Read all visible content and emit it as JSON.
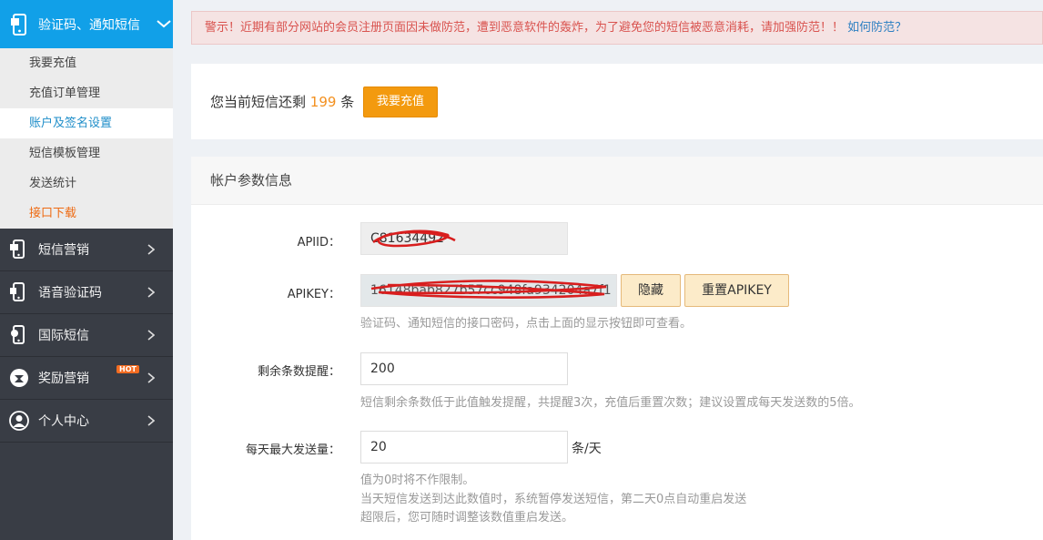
{
  "sidebar": {
    "active_menu": {
      "label": "验证码、通知短信",
      "icon": "phone-icon"
    },
    "submenu": [
      {
        "label": "我要充值",
        "state": "normal"
      },
      {
        "label": "充值订单管理",
        "state": "normal"
      },
      {
        "label": "账户及签名设置",
        "state": "selected"
      },
      {
        "label": "短信模板管理",
        "state": "normal"
      },
      {
        "label": "发送统计",
        "state": "normal"
      },
      {
        "label": "接口下载",
        "state": "highlight"
      }
    ],
    "menus": [
      {
        "label": "短信营销",
        "icon": "sms-phone-icon"
      },
      {
        "label": "语音验证码",
        "icon": "voice-phone-icon"
      },
      {
        "label": "国际短信",
        "icon": "globe-phone-icon"
      },
      {
        "label": "奖励营销",
        "icon": "reward-icon",
        "badge": "HOT"
      },
      {
        "label": "个人中心",
        "icon": "user-icon"
      }
    ]
  },
  "alert": {
    "text": "警示！近期有部分网站的会员注册页面因未做防范，遭到恶意软件的轰炸，为了避免您的短信被恶意消耗，请加强防范！！",
    "link": "如何防范？"
  },
  "balance": {
    "prefix": "您当前短信还剩",
    "count": "199",
    "suffix": "条",
    "recharge_button": "我要充值"
  },
  "account": {
    "title": "帐户参数信息",
    "apiid_label": "APIID：",
    "apiid_value": "C81634492",
    "apikey_label": "APIKEY：",
    "apikey_value": "16148bab827b57cc948fa934204a7f1",
    "hide_button": "隐藏",
    "reset_button": "重置APIKEY",
    "apikey_hint": "验证码、通知短信的接口密码，点击上面的显示按钮即可查看。",
    "remain_label": "剩余条数提醒：",
    "remain_value": "200",
    "remain_hint": "短信剩余条数低于此值触发提醒，共提醒3次，充值后重置次数；建议设置成每天发送数的5倍。",
    "daily_label": "每天最大发送量：",
    "daily_value": "20",
    "daily_unit": "条/天",
    "daily_hint_1": "值为0时将不作限制。",
    "daily_hint_2": "当天短信发送到达此数值时，系统暂停发送短信，第二天0点自动重启发送",
    "daily_hint_3": "超限后，您可随时调整该数值重启发送。"
  },
  "colors": {
    "sidebar_bg": "#393d45",
    "active_blue": "#11a0e8",
    "orange": "#f39a0f",
    "alert_red": "#d9534f",
    "link_blue": "#2c7fc2"
  }
}
